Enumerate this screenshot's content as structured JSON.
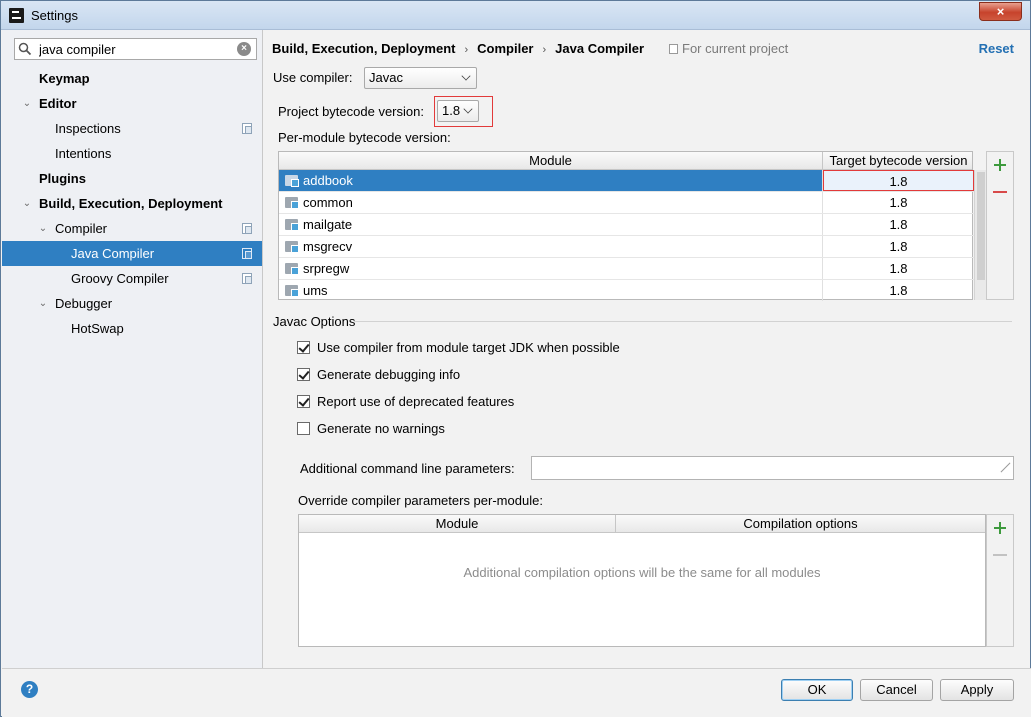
{
  "window": {
    "title": "Settings",
    "close_glyph": "×"
  },
  "search": {
    "value": "java compiler",
    "clear_glyph": "×"
  },
  "sidebar": {
    "items": [
      {
        "label": "Keymap"
      },
      {
        "label": "Editor"
      },
      {
        "label": "Inspections"
      },
      {
        "label": "Intentions"
      },
      {
        "label": "Plugins"
      },
      {
        "label": "Build, Execution, Deployment"
      },
      {
        "label": "Compiler"
      },
      {
        "label": "Java Compiler"
      },
      {
        "label": "Groovy Compiler"
      },
      {
        "label": "Debugger"
      },
      {
        "label": "HotSwap"
      }
    ],
    "arrow_expanded": "⌄"
  },
  "breadcrumb": {
    "items": [
      "Build, Execution, Deployment",
      "Compiler",
      "Java Compiler"
    ],
    "separator": "›",
    "scope": "For current project",
    "reset": "Reset"
  },
  "compiler": {
    "use_label": "Use compiler:",
    "use_value": "Javac",
    "project_bytecode_label": "Project bytecode version:",
    "project_bytecode_value": "1.8",
    "per_module_label": "Per-module bytecode version:"
  },
  "module_table": {
    "headers": [
      "Module",
      "Target bytecode version"
    ],
    "rows": [
      {
        "module": "addbook",
        "version": "1.8"
      },
      {
        "module": "common",
        "version": "1.8"
      },
      {
        "module": "mailgate",
        "version": "1.8"
      },
      {
        "module": "msgrecv",
        "version": "1.8"
      },
      {
        "module": "srpregw",
        "version": "1.8"
      },
      {
        "module": "ums",
        "version": "1.8"
      }
    ]
  },
  "javac_options": {
    "title": "Javac Options",
    "checkboxes": [
      {
        "label": "Use compiler from module target JDK when possible",
        "checked": true
      },
      {
        "label": "Generate debugging info",
        "checked": true
      },
      {
        "label": "Report use of deprecated features",
        "checked": true
      },
      {
        "label": "Generate no warnings",
        "checked": false
      }
    ],
    "additional_params_label": "Additional command line parameters:",
    "additional_params_value": "",
    "override_label": "Override compiler parameters per-module:",
    "override_headers": [
      "Module",
      "Compilation options"
    ],
    "override_empty": "Additional compilation options will be the same for all modules"
  },
  "footer": {
    "help_glyph": "?",
    "ok": "OK",
    "cancel": "Cancel",
    "apply": "Apply"
  },
  "colors": {
    "accent": "#2f7fc2",
    "highlight_frame": "#e23a3a",
    "add": "#3d9a3d",
    "remove": "#d84a4a"
  }
}
